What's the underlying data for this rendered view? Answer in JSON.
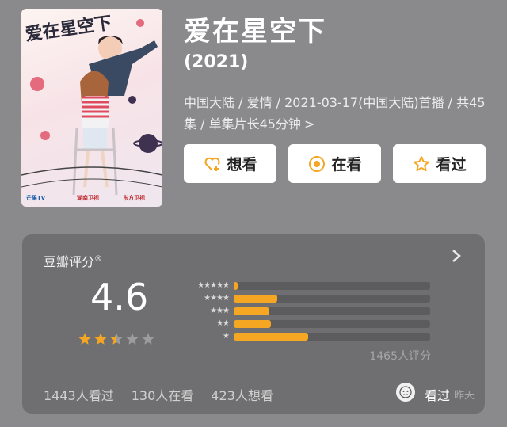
{
  "poster": {
    "alt_title": "爱在星空下",
    "badge_left": "芒果TV",
    "badge_mid": "湖南卫视",
    "badge_right": "东方卫视"
  },
  "movie": {
    "title": "爱在星空下",
    "year": "(2021)",
    "meta": "中国大陆 / 爱情 / 2021-03-17(中国大陆)首播 / 共45集 / 单集片长45分钟",
    "meta_arrow": ">"
  },
  "actions": [
    {
      "label": "想看",
      "icon": "heart-plus-icon"
    },
    {
      "label": "在看",
      "icon": "target-circle-icon"
    },
    {
      "label": "看过",
      "icon": "star-outline-icon"
    }
  ],
  "rating": {
    "title": "豆瓣评分",
    "registered_mark": "®",
    "score": "4.6",
    "score_stars": 2.5,
    "distribution": [
      {
        "stars": "★★★★★",
        "fraction": 0.02
      },
      {
        "stars": "★★★★",
        "fraction": 0.22
      },
      {
        "stars": "★★★",
        "fraction": 0.18
      },
      {
        "stars": "★★",
        "fraction": 0.19
      },
      {
        "stars": "★",
        "fraction": 0.38
      }
    ],
    "count": "1465人评分",
    "watched": "1443人看过",
    "watching": "130人在看",
    "want": "423人想看",
    "seen_label": "看过",
    "seen_time": "昨天"
  },
  "colors": {
    "accent": "#f5a623",
    "background": "#8a8a8c",
    "card": "#6f6f71"
  }
}
